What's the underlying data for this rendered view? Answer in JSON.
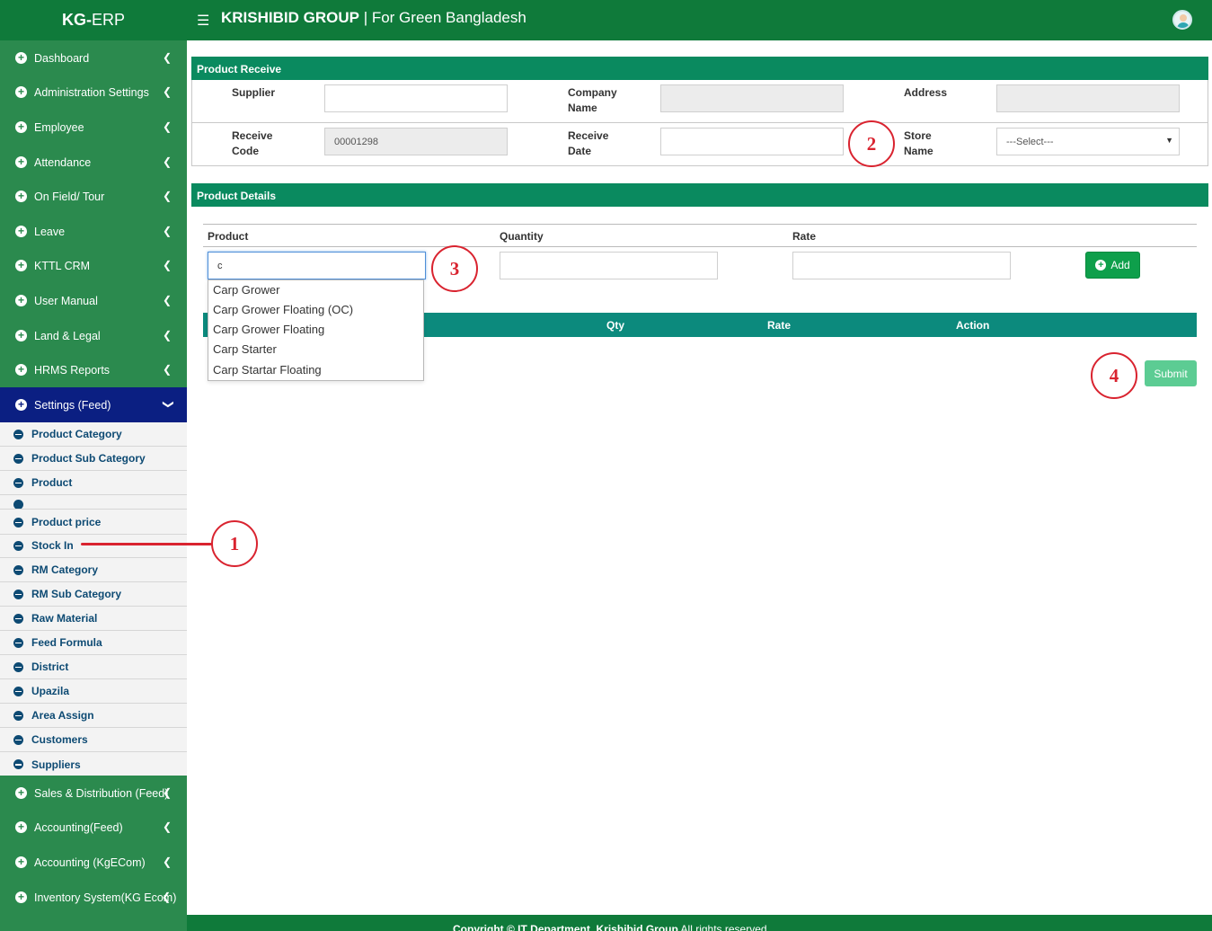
{
  "header": {
    "brand_bold": "KG-",
    "brand_rest": "ERP",
    "company": "KRISHIBID GROUP",
    "tagline": " | For Green Bangladesh",
    "menu_icon": "hamburger-icon",
    "avatar_icon": "user-avatar-icon"
  },
  "sidebar": {
    "items": [
      {
        "label": "Dashboard"
      },
      {
        "label": "Administration Settings"
      },
      {
        "label": "Employee"
      },
      {
        "label": "Attendance"
      },
      {
        "label": "On Field/ Tour"
      },
      {
        "label": "Leave"
      },
      {
        "label": "KTTL CRM"
      },
      {
        "label": "User Manual"
      },
      {
        "label": "Land & Legal"
      },
      {
        "label": "HRMS Reports"
      },
      {
        "label": "Settings (Feed)"
      },
      {
        "label": "Sales & Distribution (Feed)"
      },
      {
        "label": "Accounting(Feed)"
      },
      {
        "label": "Accounting (KgECom)"
      },
      {
        "label": "Inventory System(KG Ecom)"
      }
    ],
    "submenu": [
      {
        "label": "Product Category"
      },
      {
        "label": "Product Sub Category"
      },
      {
        "label": "Product"
      },
      {
        "label": "Product price"
      },
      {
        "label": "Stock In"
      },
      {
        "label": "RM Category"
      },
      {
        "label": "RM Sub Category"
      },
      {
        "label": "Raw Material"
      },
      {
        "label": "Feed Formula"
      },
      {
        "label": "District"
      },
      {
        "label": "Upazila"
      },
      {
        "label": "Area Assign"
      },
      {
        "label": "Customers"
      },
      {
        "label": "Suppliers"
      }
    ]
  },
  "receive": {
    "title": "Product Receive",
    "supplier_label": "Supplier",
    "supplier_value": "",
    "company_label": "Company Name",
    "company_value": "",
    "address_label": "Address",
    "address_value": "",
    "code_label": "Receive Code",
    "code_value": "00001298",
    "date_label": "Receive Date",
    "date_value": "",
    "store_label": "Store Name",
    "store_value": "---Select---"
  },
  "details": {
    "title": "Product Details",
    "product_label": "Product",
    "product_value": "c",
    "quantity_label": "Quantity",
    "quantity_value": "",
    "rate_label": "Rate",
    "rate_value": "",
    "add_label": "Add",
    "suggestions": [
      "Carp Grower",
      "Carp Grower Floating (OC)",
      "Carp Grower Floating",
      "Carp Starter",
      "Carp Startar Floating"
    ],
    "table_headers": [
      "Qty",
      "Rate",
      "Action"
    ],
    "submit_label": "Submit"
  },
  "callouts": [
    "1",
    "2",
    "3",
    "4"
  ],
  "footer": {
    "text": "Copyright © IT Department, Krishibid Group",
    "rights": " All rights reserved."
  }
}
